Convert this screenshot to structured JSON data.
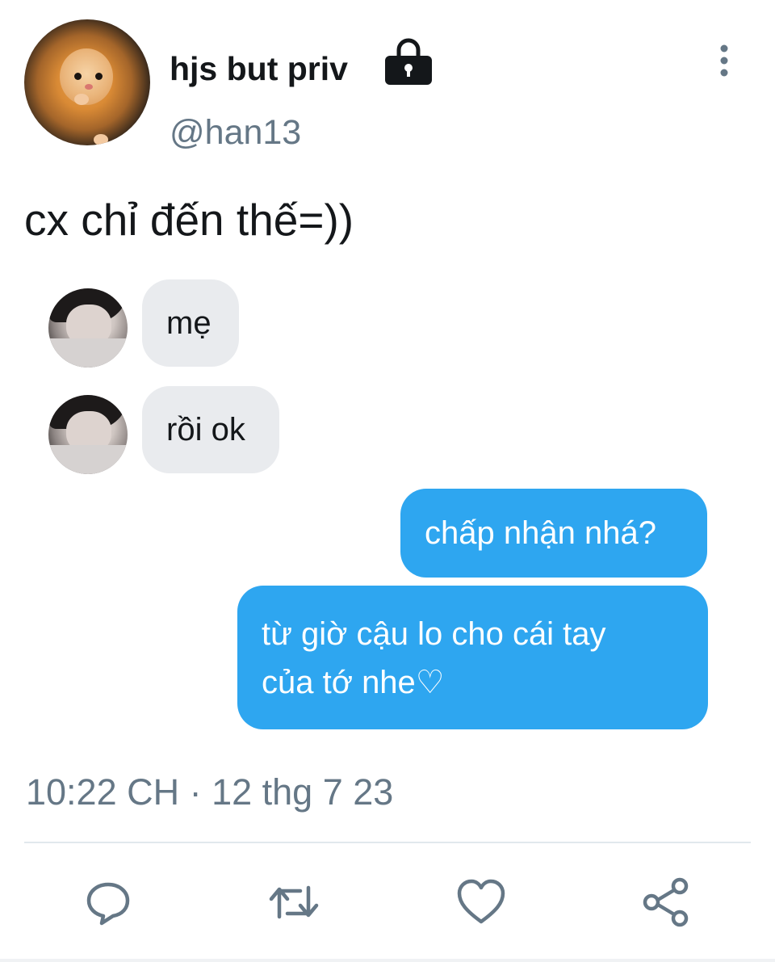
{
  "tweet": {
    "display_name": "hjs but priv",
    "handle": "@han13",
    "text": "cx chỉ đến thế=))",
    "timestamp": "10:22 CH · 12 thg 7 23",
    "icons": {
      "lock": "lock-icon",
      "more": "more-vertical-icon"
    }
  },
  "chat": {
    "incoming": [
      {
        "text": "mẹ"
      },
      {
        "text": "rồi ok"
      }
    ],
    "outgoing": [
      {
        "text": "chấp nhận nhá?"
      },
      {
        "line1": "từ giờ cậu lo cho cái tay",
        "line2": "của tớ nhe♡"
      }
    ],
    "colors": {
      "incoming_bg": "#e9ebee",
      "outgoing_bg": "#2ea6f0"
    }
  },
  "actions": [
    {
      "name": "reply",
      "icon": "reply-icon"
    },
    {
      "name": "retweet",
      "icon": "retweet-icon"
    },
    {
      "name": "like",
      "icon": "heart-icon"
    },
    {
      "name": "share",
      "icon": "share-icon"
    }
  ],
  "colors": {
    "text": "#14171a",
    "secondary": "#657786",
    "divider": "#e1e8ed"
  }
}
